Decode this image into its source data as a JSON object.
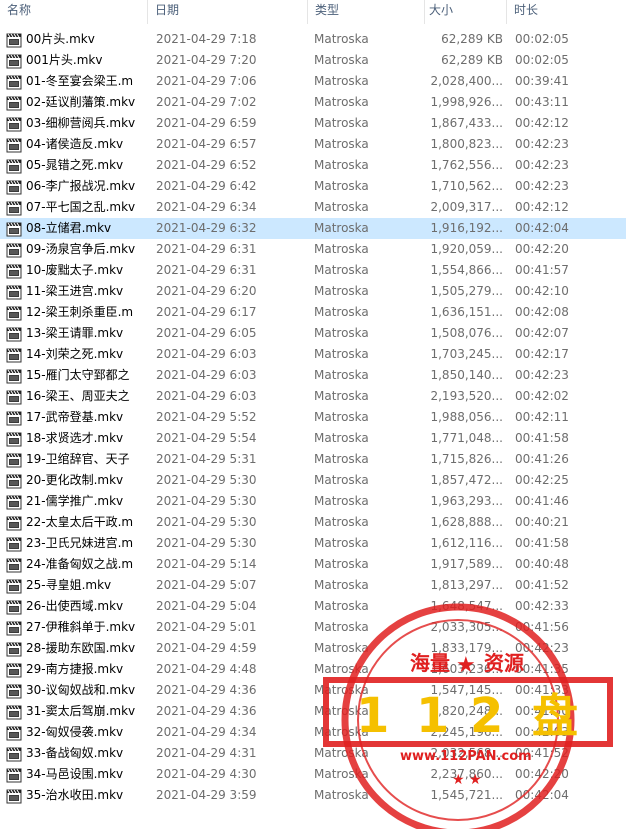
{
  "columns": {
    "name": "名称",
    "date": "日期",
    "type": "类型",
    "size": "大小",
    "duration": "时长"
  },
  "icon": "video-file-icon",
  "selected_index": 9,
  "files": [
    {
      "name": "00片头.mkv",
      "date": "2021-04-29 7:18",
      "type": "Matroska",
      "size": "62,289 KB",
      "duration": "00:02:05"
    },
    {
      "name": "001片头.mkv",
      "date": "2021-04-29 7:20",
      "type": "Matroska",
      "size": "62,289 KB",
      "duration": "00:02:05"
    },
    {
      "name": "01-冬至宴会梁王.m",
      "date": "2021-04-29 7:06",
      "type": "Matroska",
      "size": "2,028,400...",
      "duration": "00:39:41"
    },
    {
      "name": "02-廷议削藩策.mkv",
      "date": "2021-04-29 7:02",
      "type": "Matroska",
      "size": "1,998,926...",
      "duration": "00:43:11"
    },
    {
      "name": "03-细柳营阅兵.mkv",
      "date": "2021-04-29 6:59",
      "type": "Matroska",
      "size": "1,867,433...",
      "duration": "00:42:12"
    },
    {
      "name": "04-诸侯造反.mkv",
      "date": "2021-04-29 6:57",
      "type": "Matroska",
      "size": "1,800,823...",
      "duration": "00:42:23"
    },
    {
      "name": "05-晁错之死.mkv",
      "date": "2021-04-29 6:52",
      "type": "Matroska",
      "size": "1,762,556...",
      "duration": "00:42:23"
    },
    {
      "name": "06-李广报战况.mkv",
      "date": "2021-04-29 6:42",
      "type": "Matroska",
      "size": "1,710,562...",
      "duration": "00:42:23"
    },
    {
      "name": "07-平七国之乱.mkv",
      "date": "2021-04-29 6:34",
      "type": "Matroska",
      "size": "2,009,317...",
      "duration": "00:42:12"
    },
    {
      "name": "08-立储君.mkv",
      "date": "2021-04-29 6:32",
      "type": "Matroska",
      "size": "1,916,192...",
      "duration": "00:42:04"
    },
    {
      "name": "09-汤泉宫争后.mkv",
      "date": "2021-04-29 6:31",
      "type": "Matroska",
      "size": "1,920,059...",
      "duration": "00:42:20"
    },
    {
      "name": "10-废黜太子.mkv",
      "date": "2021-04-29 6:31",
      "type": "Matroska",
      "size": "1,554,866...",
      "duration": "00:41:57"
    },
    {
      "name": "11-梁王进宫.mkv",
      "date": "2021-04-29 6:20",
      "type": "Matroska",
      "size": "1,505,279...",
      "duration": "00:42:10"
    },
    {
      "name": "12-梁王刺杀重臣.m",
      "date": "2021-04-29 6:17",
      "type": "Matroska",
      "size": "1,636,151...",
      "duration": "00:42:08"
    },
    {
      "name": "13-梁王请罪.mkv",
      "date": "2021-04-29 6:05",
      "type": "Matroska",
      "size": "1,508,076...",
      "duration": "00:42:07"
    },
    {
      "name": "14-刘荣之死.mkv",
      "date": "2021-04-29 6:03",
      "type": "Matroska",
      "size": "1,703,245...",
      "duration": "00:42:17"
    },
    {
      "name": "15-雁门太守郅都之",
      "date": "2021-04-29 6:03",
      "type": "Matroska",
      "size": "1,850,140...",
      "duration": "00:42:23"
    },
    {
      "name": "16-梁王、周亚夫之",
      "date": "2021-04-29 6:03",
      "type": "Matroska",
      "size": "2,193,520...",
      "duration": "00:42:02"
    },
    {
      "name": "17-武帝登基.mkv",
      "date": "2021-04-29 5:52",
      "type": "Matroska",
      "size": "1,988,056...",
      "duration": "00:42:11"
    },
    {
      "name": "18-求贤选才.mkv",
      "date": "2021-04-29 5:54",
      "type": "Matroska",
      "size": "1,771,048...",
      "duration": "00:41:58"
    },
    {
      "name": "19-卫绾辞官、天子",
      "date": "2021-04-29 5:31",
      "type": "Matroska",
      "size": "1,715,826...",
      "duration": "00:41:26"
    },
    {
      "name": "20-更化改制.mkv",
      "date": "2021-04-29 5:30",
      "type": "Matroska",
      "size": "1,857,472...",
      "duration": "00:42:25"
    },
    {
      "name": "21-儒学推广.mkv",
      "date": "2021-04-29 5:30",
      "type": "Matroska",
      "size": "1,963,293...",
      "duration": "00:41:46"
    },
    {
      "name": "22-太皇太后干政.m",
      "date": "2021-04-29 5:30",
      "type": "Matroska",
      "size": "1,628,888...",
      "duration": "00:40:21"
    },
    {
      "name": "23-卫氏兄妹进宫.m",
      "date": "2021-04-29 5:30",
      "type": "Matroska",
      "size": "1,612,116...",
      "duration": "00:41:58"
    },
    {
      "name": "24-准备匈奴之战.m",
      "date": "2021-04-29 5:14",
      "type": "Matroska",
      "size": "1,917,589...",
      "duration": "00:40:48"
    },
    {
      "name": "25-寻皇姐.mkv",
      "date": "2021-04-29 5:07",
      "type": "Matroska",
      "size": "1,813,297...",
      "duration": "00:41:52"
    },
    {
      "name": "26-出使西域.mkv",
      "date": "2021-04-29 5:04",
      "type": "Matroska",
      "size": "1,648,547...",
      "duration": "00:42:33"
    },
    {
      "name": "27-伊稚斜单于.mkv",
      "date": "2021-04-29 5:01",
      "type": "Matroska",
      "size": "2,033,305...",
      "duration": "00:41:56"
    },
    {
      "name": "28-援助东欧国.mkv",
      "date": "2021-04-29 4:59",
      "type": "Matroska",
      "size": "1,833,179...",
      "duration": "00:42:23"
    },
    {
      "name": "29-南方捷报.mkv",
      "date": "2021-04-29 4:48",
      "type": "Matroska",
      "size": "1,603,236...",
      "duration": "00:41:35"
    },
    {
      "name": "30-议匈奴战和.mkv",
      "date": "2021-04-29 4:36",
      "type": "Matroska",
      "size": "1,547,145...",
      "duration": "00:41:33"
    },
    {
      "name": "31-窦太后驾崩.mkv",
      "date": "2021-04-29 4:36",
      "type": "Matroska",
      "size": "1,820,248...",
      "duration": "00:41:50"
    },
    {
      "name": "32-匈奴侵袭.mkv",
      "date": "2021-04-29 4:34",
      "type": "Matroska",
      "size": "2,245,196...",
      "duration": "00:42:03"
    },
    {
      "name": "33-备战匈奴.mkv",
      "date": "2021-04-29 4:31",
      "type": "Matroska",
      "size": "2,032,568...",
      "duration": "00:41:52"
    },
    {
      "name": "34-马邑设围.mkv",
      "date": "2021-04-29 4:30",
      "type": "Matroska",
      "size": "2,237,860...",
      "duration": "00:42:20"
    },
    {
      "name": "35-治水收田.mkv",
      "date": "2021-04-29 3:59",
      "type": "Matroska",
      "size": "1,545,721...",
      "duration": "00:42:04"
    }
  ],
  "watermark": {
    "top_text": "海量",
    "top_text_2": "资源",
    "star": "★",
    "main": [
      "1",
      "1",
      "2",
      "盘"
    ],
    "url": "www.112PAN.com",
    "color": "#e02020",
    "accent": "#f5c000"
  }
}
